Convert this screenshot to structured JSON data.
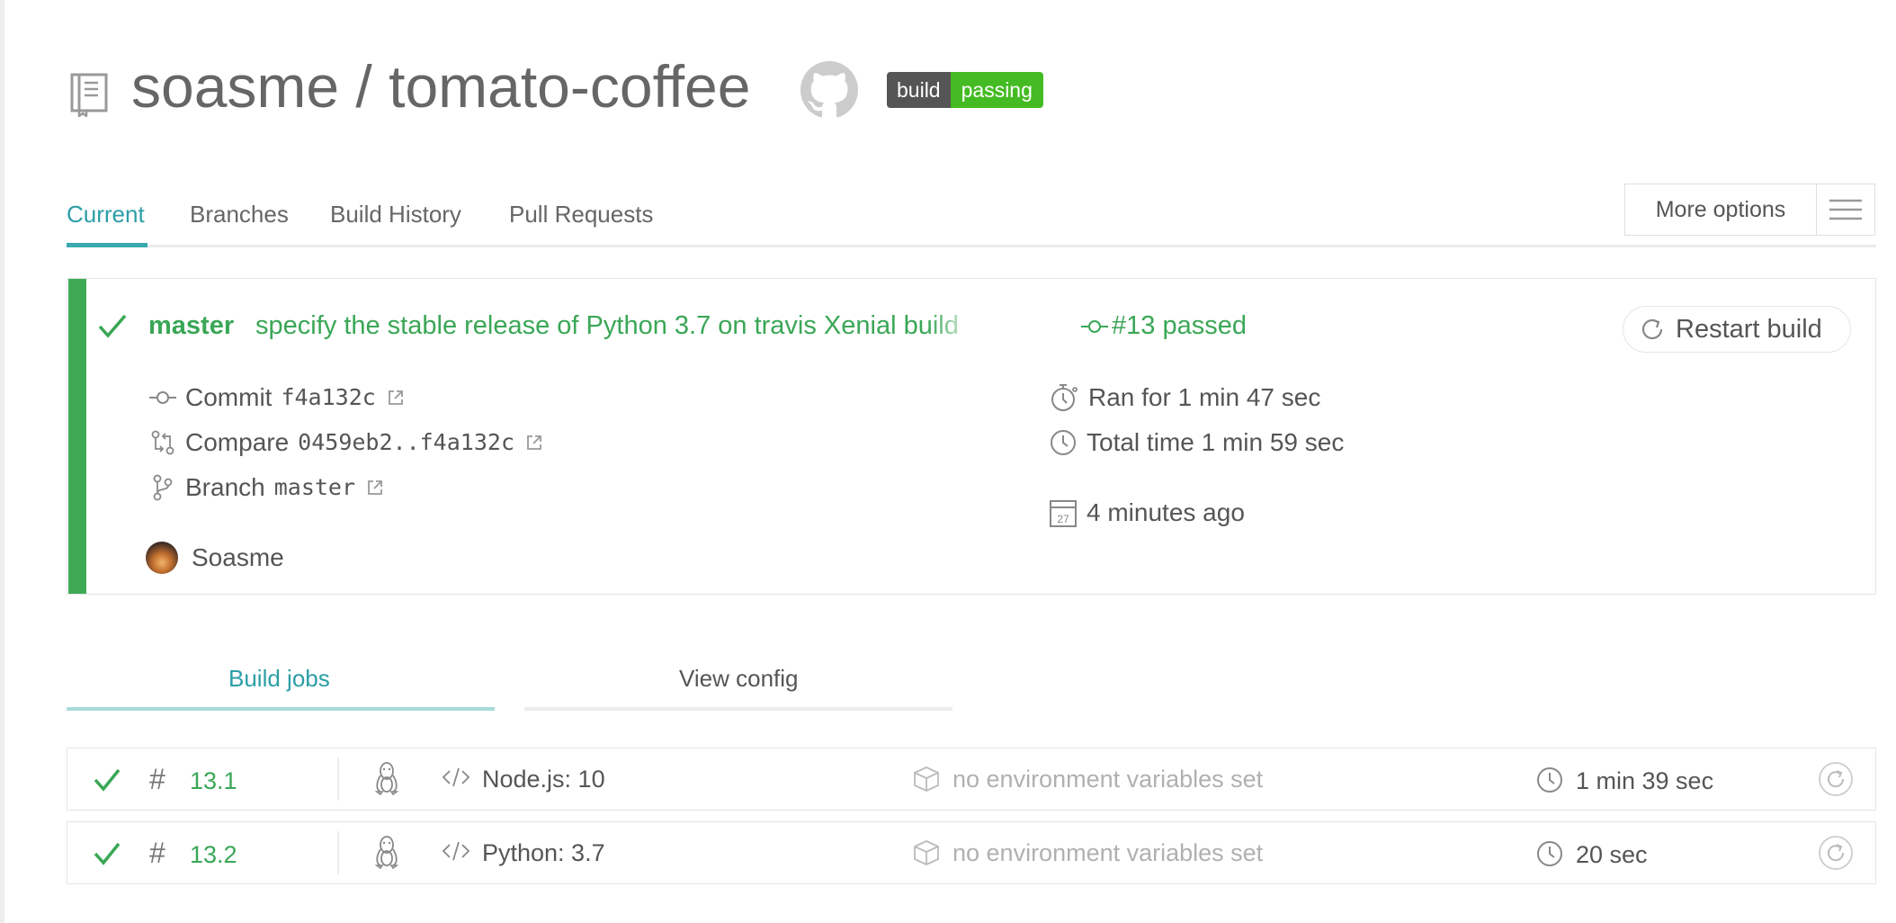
{
  "repo": {
    "title": "soasme / tomato-coffee",
    "badge_left": "build",
    "badge_right": "passing"
  },
  "tabs": [
    {
      "label": "Current",
      "active": true
    },
    {
      "label": "Branches",
      "active": false
    },
    {
      "label": "Build History",
      "active": false
    },
    {
      "label": "Pull Requests",
      "active": false
    }
  ],
  "more_options": "More options",
  "build": {
    "status": "passed",
    "branch": "master",
    "message": "specify the stable release of Python 3.7 on travis Xenial build",
    "number": "#13 passed",
    "restart_label": "Restart build",
    "commit_label": "Commit",
    "commit_sha": "f4a132c",
    "compare_label": "Compare",
    "compare_range": "0459eb2..f4a132c",
    "branch_label": "Branch",
    "branch_value": "master",
    "author": "Soasme",
    "ran_for": "Ran for 1 min 47 sec",
    "total_time": "Total time 1 min 59 sec",
    "calendar_day": "27",
    "finished": "4 minutes ago"
  },
  "build_tabs": {
    "jobs": "Build jobs",
    "config": "View config"
  },
  "jobs": [
    {
      "hash": "#",
      "number": "13.1",
      "language": "Node.js: 10",
      "env": "no environment variables set",
      "duration": "1 min 39 sec",
      "status": "passed"
    },
    {
      "hash": "#",
      "number": "13.2",
      "language": "Python: 3.7",
      "env": "no environment variables set",
      "duration": "20 sec",
      "status": "passed"
    }
  ],
  "colors": {
    "passed": "#3aa756",
    "accent": "#2c9ea6",
    "badge_green": "#44bb22"
  }
}
